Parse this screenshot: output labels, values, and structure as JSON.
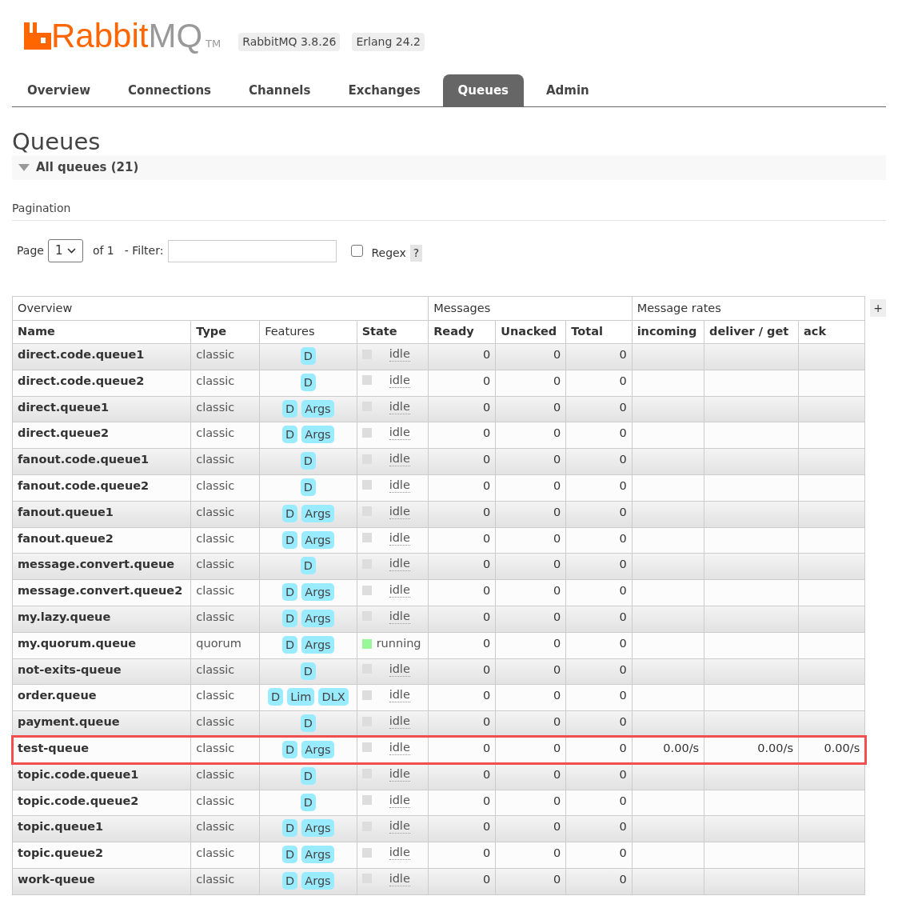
{
  "header": {
    "logo_brand": "Rabbit",
    "logo_suffix": "MQ",
    "logo_mark": "TM",
    "versions": [
      "RabbitMQ 3.8.26",
      "Erlang 24.2"
    ]
  },
  "tabs": [
    {
      "label": "Overview",
      "selected": false
    },
    {
      "label": "Connections",
      "selected": false
    },
    {
      "label": "Channels",
      "selected": false
    },
    {
      "label": "Exchanges",
      "selected": false
    },
    {
      "label": "Queues",
      "selected": true
    },
    {
      "label": "Admin",
      "selected": false
    }
  ],
  "page_title": "Queues",
  "section": {
    "title": "All queues (21)",
    "expanded": true
  },
  "pagination": {
    "title": "Pagination",
    "page_label": "Page",
    "page_value": "1",
    "of_label": "of 1",
    "filter_label": "- Filter:",
    "regex_label": "Regex",
    "regex_checked": false,
    "help": "?"
  },
  "table": {
    "groups": [
      "Overview",
      "Messages",
      "Message rates"
    ],
    "columns_toggle": "+",
    "columns": [
      {
        "label": "Name",
        "bold": true
      },
      {
        "label": "Type",
        "bold": true
      },
      {
        "label": "Features",
        "bold": false
      },
      {
        "label": "State",
        "bold": true
      },
      {
        "label": "Ready",
        "bold": true
      },
      {
        "label": "Unacked",
        "bold": true
      },
      {
        "label": "Total",
        "bold": true
      },
      {
        "label": "incoming",
        "bold": true
      },
      {
        "label": "deliver / get",
        "bold": true
      },
      {
        "label": "ack",
        "bold": true
      }
    ],
    "rows": [
      {
        "name": "direct.code.queue1",
        "type": "classic",
        "features": [
          "D"
        ],
        "state": "idle",
        "color": "#dddddd",
        "ready": "0",
        "unacked": "0",
        "total": "0",
        "highlighted": false
      },
      {
        "name": "direct.code.queue2",
        "type": "classic",
        "features": [
          "D"
        ],
        "state": "idle",
        "color": "#dddddd",
        "ready": "0",
        "unacked": "0",
        "total": "0",
        "highlighted": false
      },
      {
        "name": "direct.queue1",
        "type": "classic",
        "features": [
          "D",
          "Args"
        ],
        "state": "idle",
        "color": "#dddddd",
        "ready": "0",
        "unacked": "0",
        "total": "0",
        "highlighted": false
      },
      {
        "name": "direct.queue2",
        "type": "classic",
        "features": [
          "D",
          "Args"
        ],
        "state": "idle",
        "color": "#dddddd",
        "ready": "0",
        "unacked": "0",
        "total": "0",
        "highlighted": false
      },
      {
        "name": "fanout.code.queue1",
        "type": "classic",
        "features": [
          "D"
        ],
        "state": "idle",
        "color": "#dddddd",
        "ready": "0",
        "unacked": "0",
        "total": "0",
        "highlighted": false
      },
      {
        "name": "fanout.code.queue2",
        "type": "classic",
        "features": [
          "D"
        ],
        "state": "idle",
        "color": "#dddddd",
        "ready": "0",
        "unacked": "0",
        "total": "0",
        "highlighted": false
      },
      {
        "name": "fanout.queue1",
        "type": "classic",
        "features": [
          "D",
          "Args"
        ],
        "state": "idle",
        "color": "#dddddd",
        "ready": "0",
        "unacked": "0",
        "total": "0",
        "highlighted": false
      },
      {
        "name": "fanout.queue2",
        "type": "classic",
        "features": [
          "D",
          "Args"
        ],
        "state": "idle",
        "color": "#dddddd",
        "ready": "0",
        "unacked": "0",
        "total": "0",
        "highlighted": false
      },
      {
        "name": "message.convert.queue",
        "type": "classic",
        "features": [
          "D"
        ],
        "state": "idle",
        "color": "#dddddd",
        "ready": "0",
        "unacked": "0",
        "total": "0",
        "highlighted": false
      },
      {
        "name": "message.convert.queue2",
        "type": "classic",
        "features": [
          "D",
          "Args"
        ],
        "state": "idle",
        "color": "#dddddd",
        "ready": "0",
        "unacked": "0",
        "total": "0",
        "highlighted": false
      },
      {
        "name": "my.lazy.queue",
        "type": "classic",
        "features": [
          "D",
          "Args"
        ],
        "state": "idle",
        "color": "#dddddd",
        "ready": "0",
        "unacked": "0",
        "total": "0",
        "highlighted": false
      },
      {
        "name": "my.quorum.queue",
        "type": "quorum",
        "features": [
          "D",
          "Args"
        ],
        "state": "running",
        "color": "#98f898",
        "ready": "0",
        "unacked": "0",
        "total": "0",
        "highlighted": false
      },
      {
        "name": "not-exits-queue",
        "type": "classic",
        "features": [
          "D"
        ],
        "state": "idle",
        "color": "#dddddd",
        "ready": "0",
        "unacked": "0",
        "total": "0",
        "highlighted": false
      },
      {
        "name": "order.queue",
        "type": "classic",
        "features": [
          "D",
          "Lim",
          "DLX"
        ],
        "state": "idle",
        "color": "#dddddd",
        "ready": "0",
        "unacked": "0",
        "total": "0",
        "highlighted": false
      },
      {
        "name": "payment.queue",
        "type": "classic",
        "features": [
          "D"
        ],
        "state": "idle",
        "color": "#dddddd",
        "ready": "0",
        "unacked": "0",
        "total": "0",
        "highlighted": false
      },
      {
        "name": "test-queue",
        "type": "classic",
        "features": [
          "D",
          "Args"
        ],
        "state": "idle",
        "color": "#dddddd",
        "ready": "0",
        "unacked": "0",
        "total": "0",
        "incoming": "0.00/s",
        "deliver_get": "0.00/s",
        "ack": "0.00/s",
        "highlighted": true
      },
      {
        "name": "topic.code.queue1",
        "type": "classic",
        "features": [
          "D"
        ],
        "state": "idle",
        "color": "#dddddd",
        "ready": "0",
        "unacked": "0",
        "total": "0",
        "highlighted": false
      },
      {
        "name": "topic.code.queue2",
        "type": "classic",
        "features": [
          "D"
        ],
        "state": "idle",
        "color": "#dddddd",
        "ready": "0",
        "unacked": "0",
        "total": "0",
        "highlighted": false
      },
      {
        "name": "topic.queue1",
        "type": "classic",
        "features": [
          "D",
          "Args"
        ],
        "state": "idle",
        "color": "#dddddd",
        "ready": "0",
        "unacked": "0",
        "total": "0",
        "highlighted": false
      },
      {
        "name": "topic.queue2",
        "type": "classic",
        "features": [
          "D",
          "Args"
        ],
        "state": "idle",
        "color": "#dddddd",
        "ready": "0",
        "unacked": "0",
        "total": "0",
        "highlighted": false
      },
      {
        "name": "work-queue",
        "type": "classic",
        "features": [
          "D",
          "Args"
        ],
        "state": "idle",
        "color": "#dddddd",
        "ready": "0",
        "unacked": "0",
        "total": "0",
        "highlighted": false
      }
    ]
  }
}
